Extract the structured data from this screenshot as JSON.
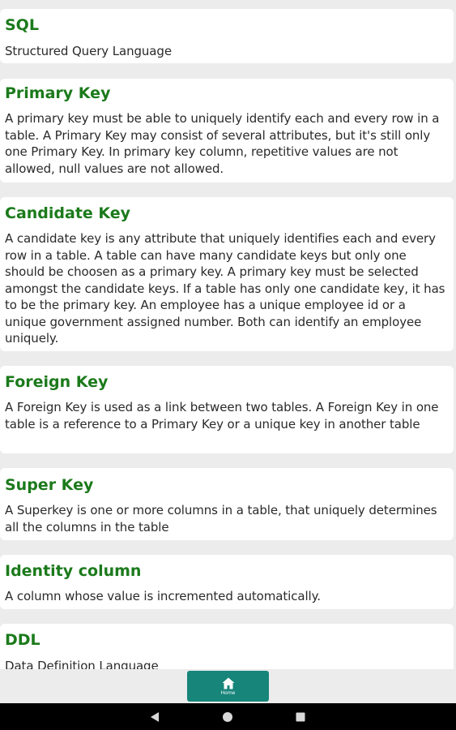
{
  "terms": [
    {
      "title": "SQL",
      "description": "Structured Query Language"
    },
    {
      "title": "Primary Key",
      "description": "A primary key must be able to uniquely identify each and every row in a table. A Primary Key may consist of several attributes, but it's still only one Primary Key. In primary key column, repetitive values are not allowed, null values are not allowed."
    },
    {
      "title": "Candidate Key",
      "description": "A candidate key is any attribute that uniquely identifies each and every row in a table. A table can have many candidate keys but only one should be choosen as a primary key. A primary key must be selected amongst the candidate keys. If a table has only one candidate key, it has to be the primary key. An employee has a unique employee id or a unique government assigned number. Both can identify an employee uniquely."
    },
    {
      "title": "Foreign Key",
      "description": "A Foreign Key is used as a link between two tables. A Foreign Key in one table is a reference to a Primary Key or a unique key in another table"
    },
    {
      "title": "Super Key",
      "description": "A Superkey is one or more columns in a table, that uniquely determines all the columns in the table"
    },
    {
      "title": "Identity column",
      "description": "A column whose value is incremented automatically."
    },
    {
      "title": "DDL",
      "description": "Data Definition Language"
    }
  ],
  "bottom_nav": {
    "home_label": "Home",
    "home_icon": "home-icon",
    "button_color": "#17857a"
  },
  "system_nav": {
    "back_icon": "back-icon",
    "home_icon": "home-circle-icon",
    "recents_icon": "recents-icon"
  },
  "colors": {
    "title": "#1b7a1b",
    "background": "#ececec",
    "card": "#ffffff"
  }
}
